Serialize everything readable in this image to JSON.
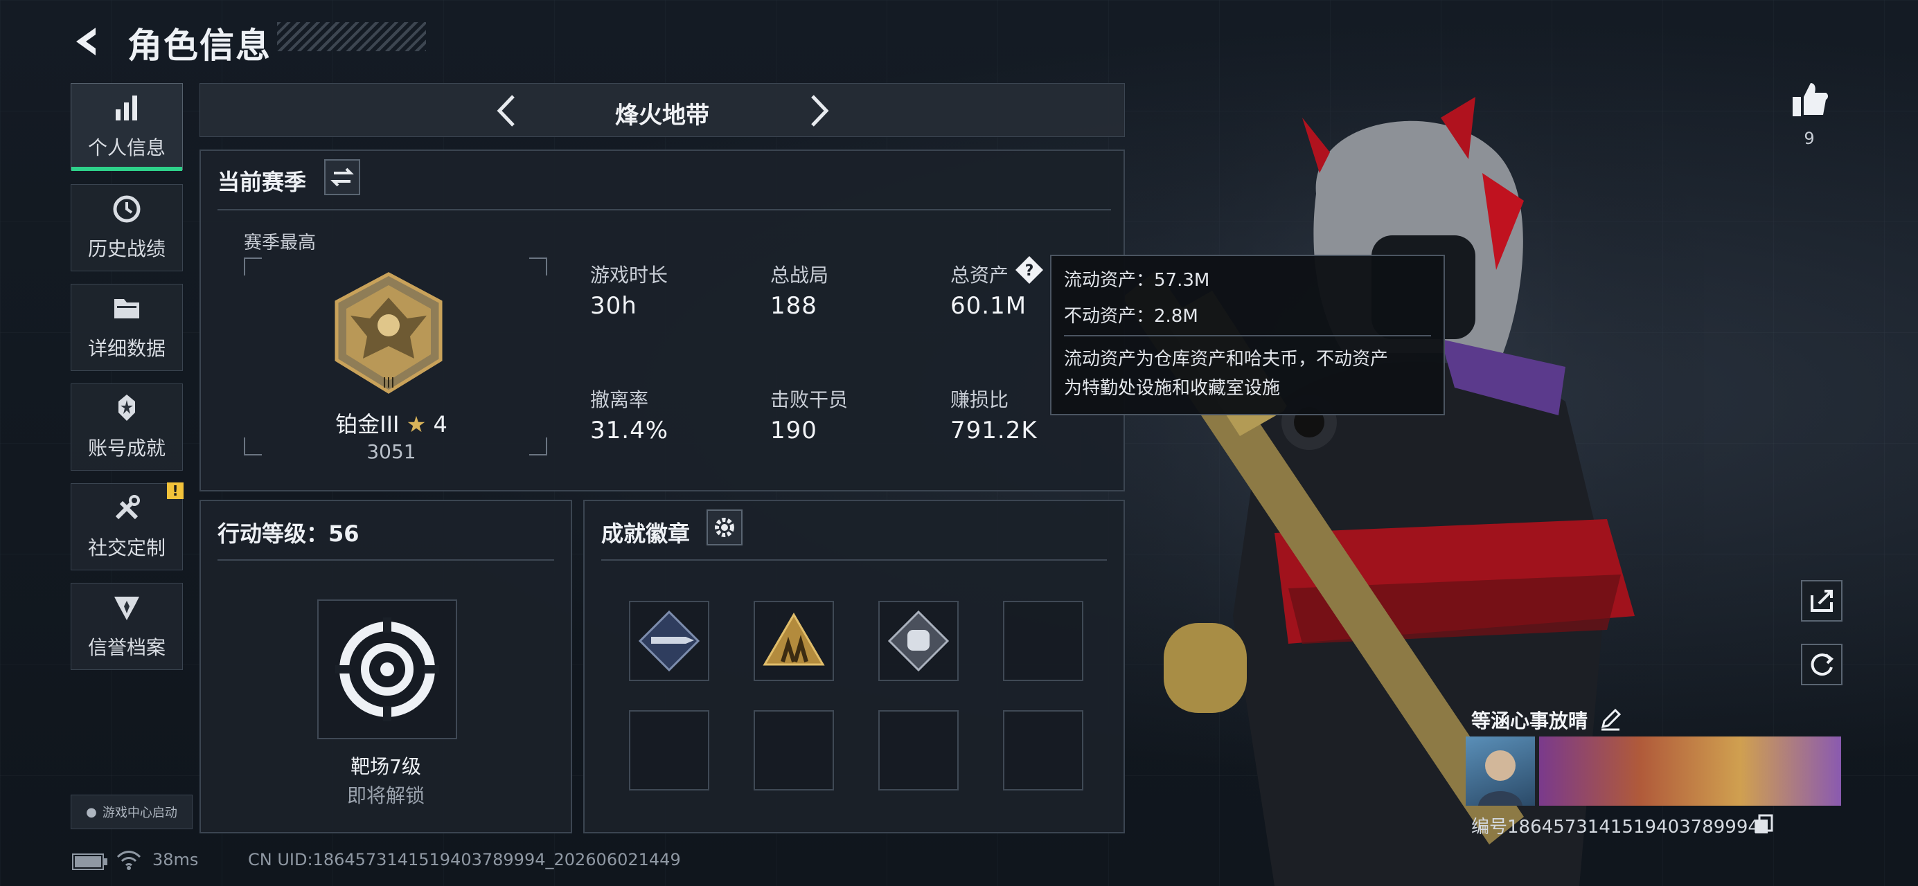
{
  "header": {
    "title": "角色信息"
  },
  "sidebar": {
    "items": [
      {
        "label": "个人信息",
        "icon": "bar-chart-icon",
        "active": true
      },
      {
        "label": "历史战绩",
        "icon": "history-icon"
      },
      {
        "label": "详细数据",
        "icon": "folder-icon"
      },
      {
        "label": "账号成就",
        "icon": "achievement-icon"
      },
      {
        "label": "社交定制",
        "icon": "tools-icon",
        "badge": "!"
      },
      {
        "label": "信誉档案",
        "icon": "credit-shield-icon"
      }
    ],
    "game_center": "游戏中心启动"
  },
  "season_bar": {
    "name": "烽火地带"
  },
  "current_season": {
    "title": "当前赛季",
    "best_label": "赛季最高",
    "rank": {
      "name": "铂金III",
      "star_count": "4",
      "score": "3051",
      "badge_numeral": "III"
    },
    "stats": [
      {
        "label": "游戏时长",
        "value": "30h"
      },
      {
        "label": "总战局",
        "value": "188"
      },
      {
        "label": "总资产",
        "value": "60.1M"
      },
      {
        "label": "撤离率",
        "value": "31.4%"
      },
      {
        "label": "击败干员",
        "value": "190"
      },
      {
        "label": "赚损比",
        "value": "791.2K"
      }
    ]
  },
  "tooltip": {
    "liquid": "流动资产：57.3M",
    "fixed": "不动资产：2.8M",
    "desc_line1": "流动资产为仓库资产和哈夫币，不动资产",
    "desc_line2": "为特勤处设施和收藏室设施"
  },
  "action_level": {
    "title": "行动等级：56",
    "target_name": "靶场7级",
    "target_status": "即将解锁"
  },
  "achievements": {
    "title": "成就徽章",
    "badges": [
      "missile-badge-icon",
      "triangle-soldiers-badge-icon",
      "fist-badge-icon",
      "",
      "",
      "",
      "",
      ""
    ]
  },
  "profile": {
    "likes": "9",
    "player_name": "等涵心事放晴",
    "id_line": "编号1864573141519403789994"
  },
  "status_bar": {
    "ping": "38ms",
    "uid": "CN UID:1864573141519403789994_202606021449"
  },
  "colors": {
    "accent": "#2ed18a",
    "warning": "#f2c23a",
    "gold": "#c9a25a"
  }
}
